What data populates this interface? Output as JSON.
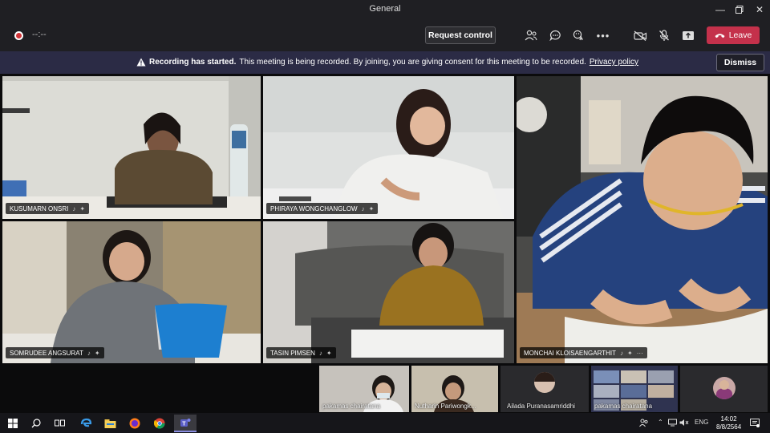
{
  "window": {
    "title": "General"
  },
  "toolbar": {
    "timer": "--:--",
    "request_control": "Request control",
    "leave": "Leave",
    "icons": [
      "participants-icon",
      "chat-icon",
      "reactions-icon",
      "more-icon",
      "camera-off-icon",
      "mic-off-icon",
      "share-tray-icon"
    ]
  },
  "banner": {
    "bold": "Recording has started.",
    "text": "This meeting is being recorded. By joining, you are giving consent for this meeting to be recorded.",
    "link": "Privacy policy",
    "dismiss": "Dismiss"
  },
  "participants": [
    {
      "name": "KUSUMARN ONSRI"
    },
    {
      "name": "PHIRAYA WONGCHANGLOW"
    },
    {
      "name": "MONCHAI KLOISAENGARTHIT"
    },
    {
      "name": "SOMRUDEE ANGSURAT"
    },
    {
      "name": "TASIN PIMSEN"
    }
  ],
  "strip": [
    {
      "name": "pakamas chairatana"
    },
    {
      "name": "Nutharin Pariwongk..."
    },
    {
      "name": "Ailada Puranasamriddhi"
    },
    {
      "name": "pakamas chairatana"
    }
  ],
  "taskbar": {
    "lang": "ENG",
    "time": "14:02",
    "date": "8/8/2564"
  },
  "colors": {
    "leave": "#c4314b",
    "banner": "#2b2b45",
    "record": "#d13438"
  }
}
